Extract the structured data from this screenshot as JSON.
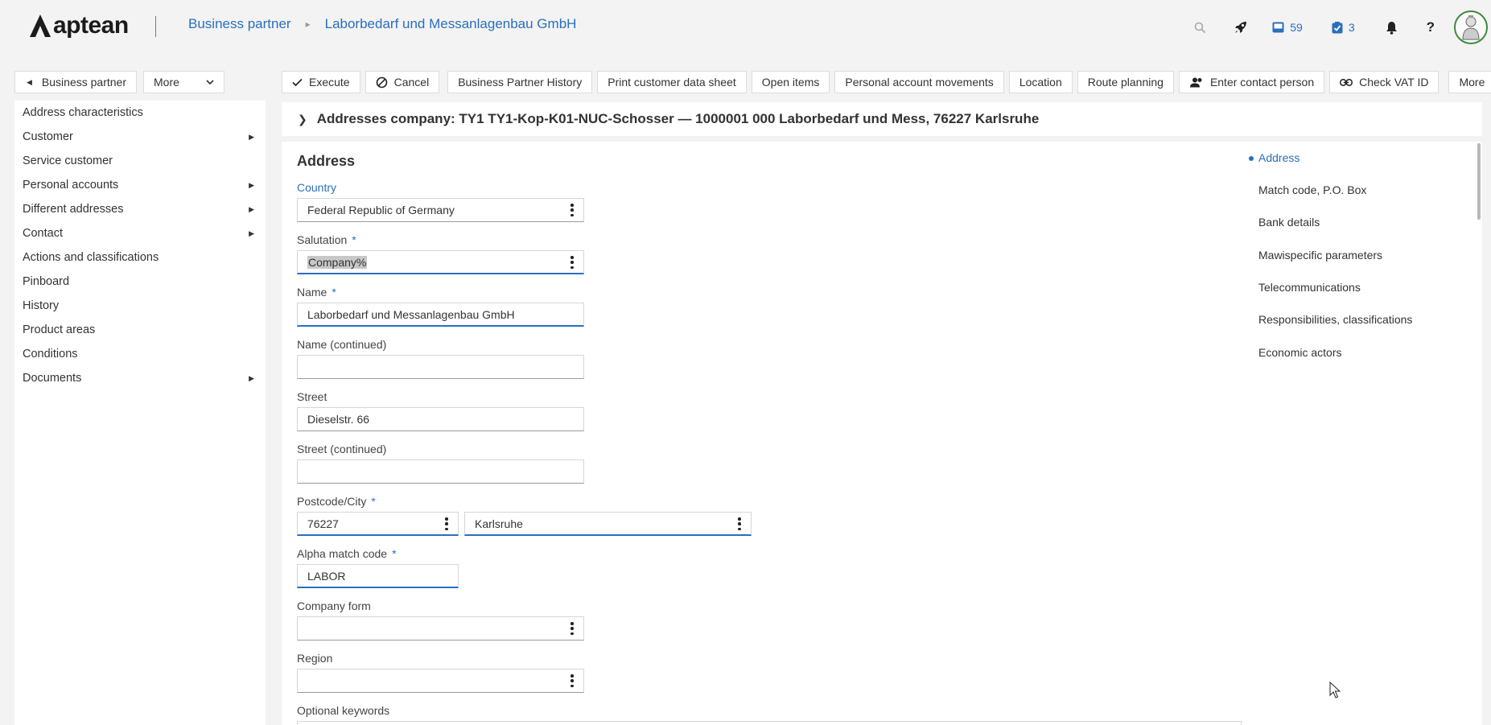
{
  "app": {
    "logo_text": "aptean"
  },
  "breadcrumb": {
    "items": [
      "Business partner",
      "Laborbedarf und Messanlagenbau GmbH"
    ]
  },
  "header": {
    "inbox_count": "59",
    "tasks_count": "3"
  },
  "sidebar": {
    "back_label": "Business partner",
    "more_label": "More",
    "items": [
      {
        "label": "Address characteristics",
        "has_children": false
      },
      {
        "label": "Customer",
        "has_children": true
      },
      {
        "label": "Service customer",
        "has_children": false
      },
      {
        "label": "Personal accounts",
        "has_children": true
      },
      {
        "label": "Different addresses",
        "has_children": true
      },
      {
        "label": "Contact",
        "has_children": true
      },
      {
        "label": "Actions and classifications",
        "has_children": false
      },
      {
        "label": "Pinboard",
        "has_children": false
      },
      {
        "label": "History",
        "has_children": false
      },
      {
        "label": "Product areas",
        "has_children": false
      },
      {
        "label": "Conditions",
        "has_children": false
      },
      {
        "label": "Documents",
        "has_children": true
      }
    ]
  },
  "toolbar": {
    "execute": "Execute",
    "cancel": "Cancel",
    "bp_history": "Business Partner History",
    "print_sheet": "Print customer data sheet",
    "open_items": "Open items",
    "personal_movements": "Personal account movements",
    "location": "Location",
    "route_planning": "Route planning",
    "enter_contact": "Enter contact person",
    "check_vat": "Check VAT ID",
    "more": "More"
  },
  "titlebar": {
    "title": "Addresses company: TY1 TY1-Kop-K01-NUC-Schosser — 1000001 000 Laborbedarf und Mess, 76227 Karlsruhe"
  },
  "form": {
    "section_title": "Address",
    "country": {
      "label": "Country",
      "value": "Federal Republic of Germany"
    },
    "salutation": {
      "label": "Salutation",
      "required": "*",
      "value": "Company%"
    },
    "name": {
      "label": "Name",
      "required": "*",
      "value": "Laborbedarf und Messanlagenbau GmbH"
    },
    "name_cont": {
      "label": "Name (continued)",
      "value": ""
    },
    "street": {
      "label": "Street",
      "value": "Dieselstr. 66"
    },
    "street_cont": {
      "label": "Street (continued)",
      "value": ""
    },
    "postcode_city": {
      "label": "Postcode/City",
      "required": "*",
      "postcode": "76227",
      "city": "Karlsruhe"
    },
    "alpha_match": {
      "label": "Alpha match code",
      "required": "*",
      "value": "LABOR"
    },
    "company_form": {
      "label": "Company form",
      "value": ""
    },
    "region": {
      "label": "Region",
      "value": ""
    },
    "optional_keywords": {
      "label": "Optional keywords"
    }
  },
  "anchors": [
    "Address",
    "Match code, P.O. Box",
    "Bank details",
    "Mawispecific parameters",
    "Telecommunications",
    "Responsibilities, classifications",
    "Economic actors"
  ],
  "colors": {
    "accent": "#2a6fbf",
    "background": "#f3f3f3",
    "avatar_ring": "#3d8a3d"
  }
}
